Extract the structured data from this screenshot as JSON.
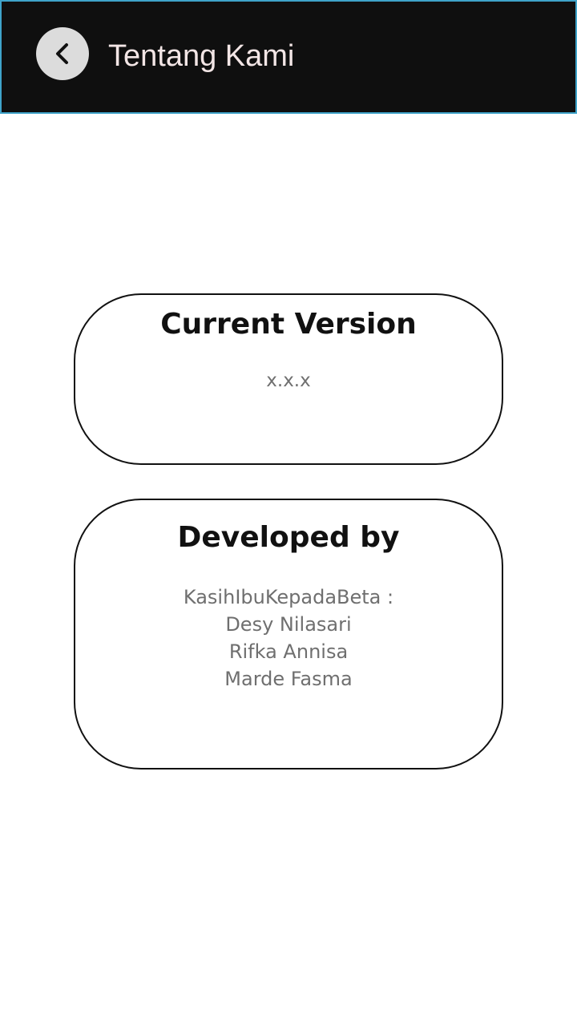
{
  "header": {
    "title": "Tentang Kami",
    "back_icon": "chevron-left-icon",
    "background": "#0f0f0f",
    "border_color": "#3fa3c9"
  },
  "version_card": {
    "title": "Current Version",
    "value": "x.x.x"
  },
  "developer_card": {
    "title": "Developed by",
    "team": "KasihIbuKepadaBeta :",
    "members": [
      "Desy Nilasari",
      "Rifka Annisa",
      "Marde Fasma"
    ]
  }
}
